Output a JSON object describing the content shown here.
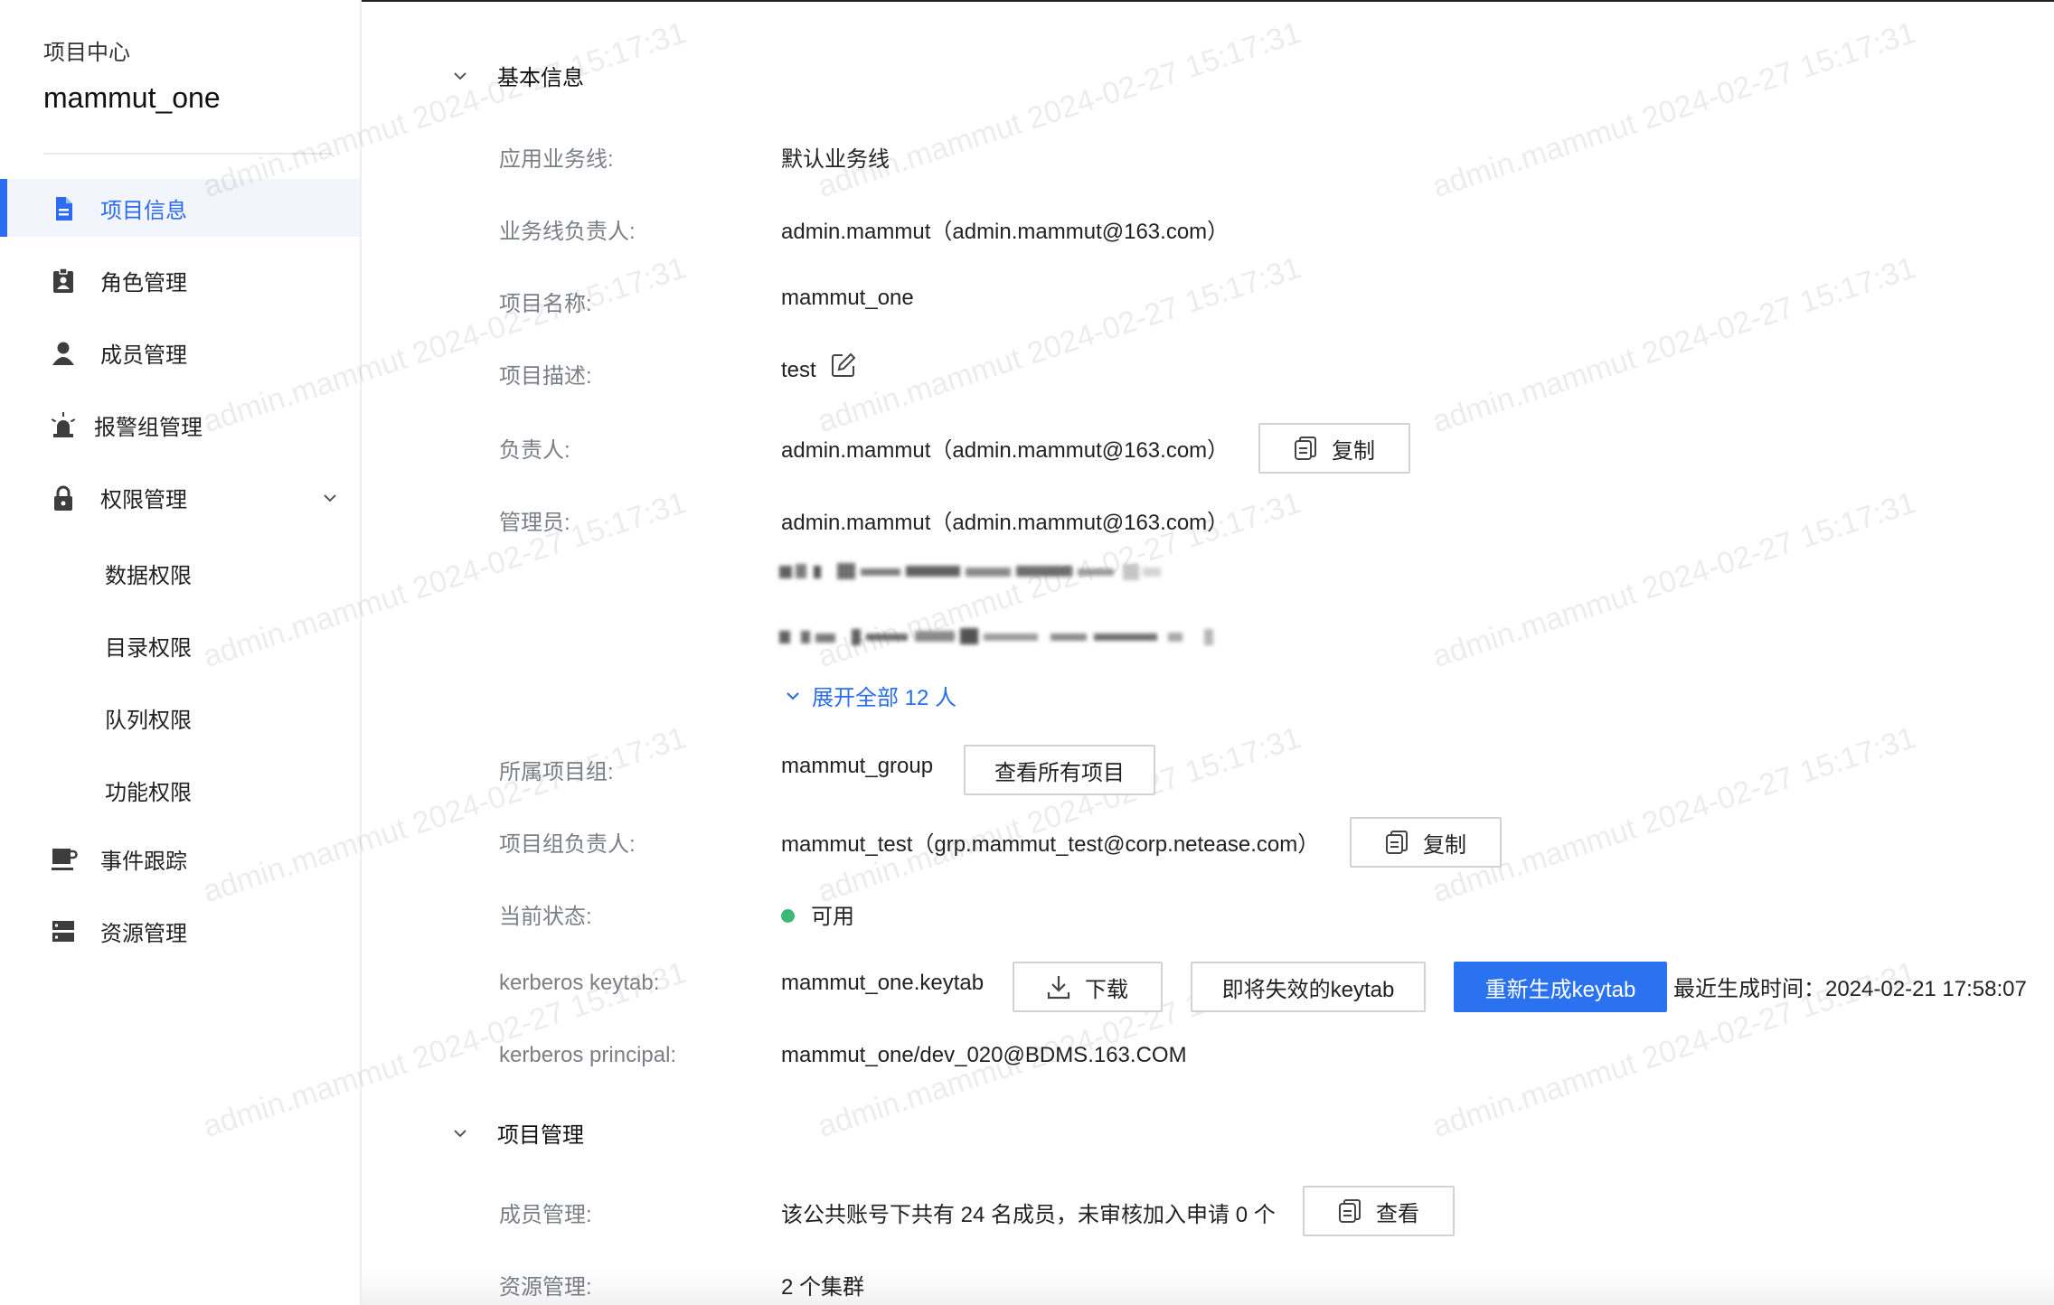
{
  "sidebar": {
    "breadcrumb": "项目中心",
    "project_name": "mammut_one",
    "items": [
      {
        "label": "项目信息",
        "icon": "document-icon",
        "active": true
      },
      {
        "label": "角色管理",
        "icon": "role-badge-icon"
      },
      {
        "label": "成员管理",
        "icon": "user-icon"
      },
      {
        "label": "报警组管理",
        "icon": "alarm-icon"
      },
      {
        "label": "权限管理",
        "icon": "lock-icon"
      },
      {
        "label": "事件跟踪",
        "icon": "coffee-icon"
      },
      {
        "label": "资源管理",
        "icon": "server-icon"
      }
    ],
    "sub_items": [
      "数据权限",
      "目录权限",
      "队列权限",
      "功能权限"
    ]
  },
  "basic": {
    "title": "基本信息",
    "business_line_label": "应用业务线:",
    "business_line": "默认业务线",
    "bl_owner_label": "业务线负责人:",
    "bl_owner": "admin.mammut（admin.mammut@163.com）",
    "name_label": "项目名称:",
    "name": "mammut_one",
    "desc_label": "项目描述:",
    "desc": "test",
    "owner_label": "负责人:",
    "owner": "admin.mammut（admin.mammut@163.com）",
    "copy_label": "复制",
    "admin_label": "管理员:",
    "admin": "admin.mammut（admin.mammut@163.com）",
    "expand_label": "展开全部 12 人",
    "group_label": "所属项目组:",
    "group": "mammut_group",
    "view_all_label": "查看所有项目",
    "group_owner_label": "项目组负责人:",
    "group_owner": "mammut_test（grp.mammut_test@corp.netease.com）",
    "status_label": "当前状态:",
    "status": "可用",
    "status_color": "#3cb877",
    "keytab_label": "kerberos keytab:",
    "keytab": "mammut_one.keytab",
    "download_label": "下载",
    "expiring_label": "即将失效的keytab",
    "regen_label": "重新生成keytab",
    "last_gen": "最近生成时间：2024-02-21 17:58:07",
    "principal_label": "kerberos principal:",
    "principal": "mammut_one/dev_020@BDMS.163.COM"
  },
  "manage": {
    "title": "项目管理",
    "member_label": "成员管理:",
    "member_text": "该公共账号下共有 24 名成员，未审核加入申请 0 个",
    "view_label": "查看",
    "resource_label": "资源管理:",
    "resource_text": "2 个集群"
  },
  "watermark": "admin.mammut 2024-02-27 15:17:31",
  "accent_color": "#2b6cf0"
}
